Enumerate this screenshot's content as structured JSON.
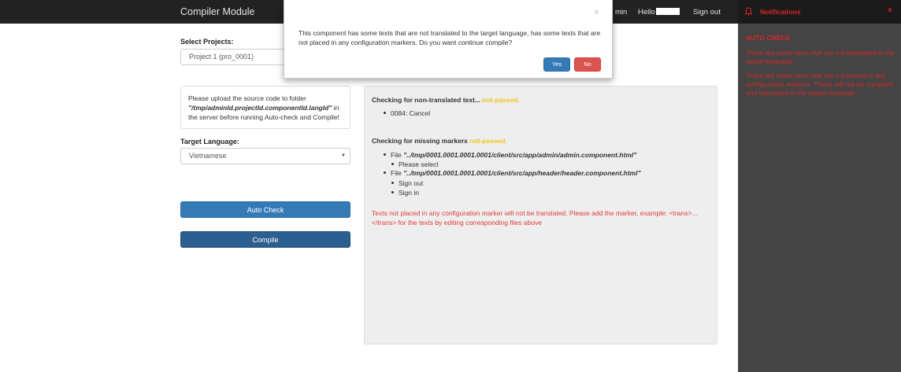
{
  "navbar": {
    "brand": "Compiler Module",
    "admin_text": "min",
    "hello_text": "Hello",
    "signout": "Sign out"
  },
  "form": {
    "projects_label": "Select Projects:",
    "project_value": "Project 1 (pro_0001)",
    "info_line1": "Please upload the source code to folder",
    "info_path": "\"/tmp/adminId.projectId.componentId.langId\"",
    "info_in": " in",
    "info_line3": "the server before running Auto-check and Compile!",
    "language_label": "Target Language:",
    "language_value": "Vietnamese",
    "auto_check_label": "Auto Check",
    "compile_label": "Compile"
  },
  "results": {
    "non_translated_heading": "Checking for non-translated text...",
    "non_translated_status": "not-passed.",
    "non_translated_items": [
      "0084: Cancel"
    ],
    "missing_markers_heading": "Checking for missing markers",
    "missing_markers_status": "not-passed.",
    "files": [
      {
        "file_label": "File ",
        "path": "\"../tmp/0001.0001.0001.0001/client/src/app/admin/admin.component.html\"",
        "texts": [
          "Please select"
        ]
      },
      {
        "file_label": "File ",
        "path": "\"../tmp/0001.0001.0001.0001/client/src/app/header/header.component.html\"",
        "texts": [
          "Sign out",
          "Sign in"
        ]
      }
    ],
    "warning": "Texts not placed in any configuration marker will not be translated. Please add the marker, example: <trans>...</trans> for the texts by editing corresponding files above"
  },
  "notifications": {
    "title": "Notifications",
    "close": "×",
    "section": "AUTO CHECK",
    "messages": [
      "There are some texts that are not translated to the target language.",
      "There are some texts that are not placed in any configuration markers. These will not be compiled and translated to the target language."
    ]
  },
  "modal": {
    "close": "×",
    "message": "This component has some texts that are not translated to the target language, has some texts that are not placed in any configuration markers. Do you want continue compile?",
    "yes": "Yes",
    "no": "No"
  },
  "colors": {
    "accent": "#337ab7",
    "compile": "#2b5f8f",
    "status_warning": "#f0c419",
    "error": "#e03a3a",
    "navbar": "#222222",
    "notification_panel": "#444444"
  },
  "icons": {
    "notification": "bell-icon",
    "select": "caret-down-icon"
  }
}
